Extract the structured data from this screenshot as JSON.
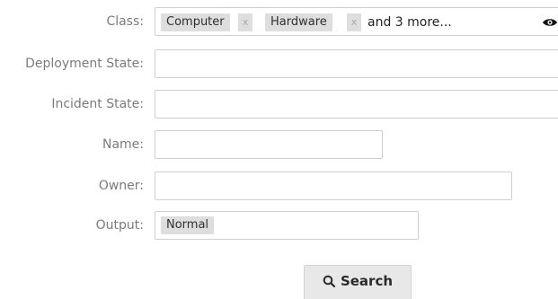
{
  "form": {
    "class": {
      "label": "Class:",
      "tags": [
        "Computer",
        "Hardware"
      ],
      "tag_remove_label": "x",
      "more_text": "and 3 more...",
      "icon": "eye-icon"
    },
    "deployment_state": {
      "label": "Deployment State:",
      "value": ""
    },
    "incident_state": {
      "label": "Incident State:",
      "value": ""
    },
    "name": {
      "label": "Name:",
      "value": ""
    },
    "owner": {
      "label": "Owner:",
      "value": ""
    },
    "output": {
      "label": "Output:",
      "selected": "Normal"
    }
  },
  "actions": {
    "search_label": "Search",
    "search_icon": "search-icon"
  }
}
